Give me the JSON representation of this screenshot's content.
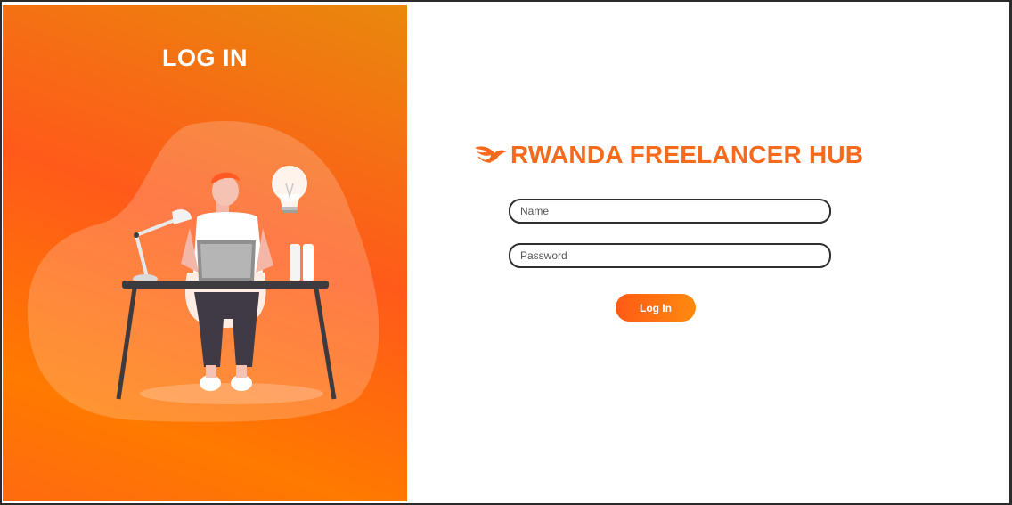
{
  "left_panel": {
    "title": "LOG IN"
  },
  "brand": {
    "icon": "phoenix-logo-icon",
    "name": "RWANDA FREELANCER HUB"
  },
  "form": {
    "name_placeholder": "Name",
    "name_value": "",
    "password_placeholder": "Password",
    "password_value": "",
    "submit_label": "Log In"
  },
  "colors": {
    "brand": "#f56a1c",
    "panel_gradient_start": "#e9880c",
    "panel_gradient_mid": "#ff5a1a",
    "button_gradient_start": "#ff5a14",
    "button_gradient_end": "#ff8a10"
  }
}
